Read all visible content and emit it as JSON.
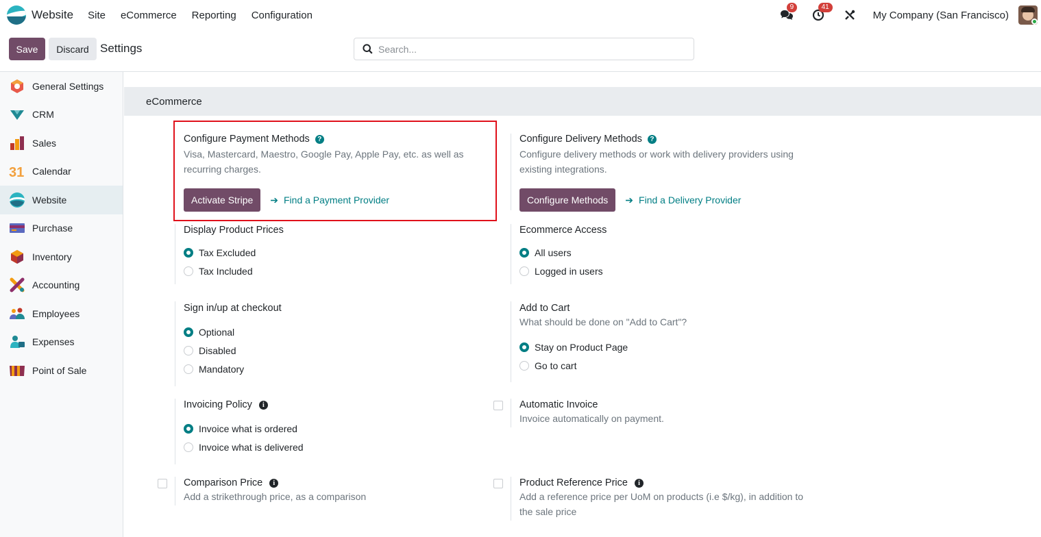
{
  "navbar": {
    "app_name": "Website",
    "menu": [
      "Site",
      "eCommerce",
      "Reporting",
      "Configuration"
    ],
    "messages_count": "9",
    "activities_count": "41",
    "company": "My Company (San Francisco)"
  },
  "control": {
    "save_label": "Save",
    "discard_label": "Discard",
    "title": "Settings",
    "search_placeholder": "Search..."
  },
  "sidebar": {
    "items": [
      {
        "label": "General Settings",
        "icon": "general-settings-icon"
      },
      {
        "label": "CRM",
        "icon": "crm-icon"
      },
      {
        "label": "Sales",
        "icon": "sales-icon"
      },
      {
        "label": "Calendar",
        "icon": "calendar-icon"
      },
      {
        "label": "Website",
        "icon": "website-icon",
        "active": true
      },
      {
        "label": "Purchase",
        "icon": "purchase-icon"
      },
      {
        "label": "Inventory",
        "icon": "inventory-icon"
      },
      {
        "label": "Accounting",
        "icon": "accounting-icon"
      },
      {
        "label": "Employees",
        "icon": "employees-icon"
      },
      {
        "label": "Expenses",
        "icon": "expenses-icon"
      },
      {
        "label": "Point of Sale",
        "icon": "point-of-sale-icon"
      }
    ],
    "calendar_number": "31"
  },
  "section": {
    "title": "eCommerce"
  },
  "payment": {
    "title": "Configure Payment Methods",
    "desc": "Visa, Mastercard, Maestro, Google Pay, Apple Pay, etc. as well as recurring charges.",
    "button": "Activate Stripe",
    "link": "Find a Payment Provider"
  },
  "delivery": {
    "title": "Configure Delivery Methods",
    "desc": "Configure delivery methods or work with delivery providers using existing integrations.",
    "button": "Configure Methods",
    "link": "Find a Delivery Provider"
  },
  "prices": {
    "title": "Display Product Prices",
    "options": [
      "Tax Excluded",
      "Tax Included"
    ],
    "selected": 0
  },
  "access": {
    "title": "Ecommerce Access",
    "options": [
      "All users",
      "Logged in users"
    ],
    "selected": 0
  },
  "signin": {
    "title": "Sign in/up at checkout",
    "options": [
      "Optional",
      "Disabled",
      "Mandatory"
    ],
    "selected": 0
  },
  "cart": {
    "title": "Add to Cart",
    "desc": "What should be done on \"Add to Cart\"?",
    "options": [
      "Stay on Product Page",
      "Go to cart"
    ],
    "selected": 0
  },
  "invoicing": {
    "title": "Invoicing Policy",
    "options": [
      "Invoice what is ordered",
      "Invoice what is delivered"
    ],
    "selected": 0
  },
  "auto_invoice": {
    "title": "Automatic Invoice",
    "desc": "Invoice automatically on payment."
  },
  "comparison": {
    "title": "Comparison Price",
    "desc": "Add a strikethrough price, as a comparison"
  },
  "reference": {
    "title": "Product Reference Price",
    "desc": "Add a reference price per UoM on products (i.e $/kg), in addition to the sale price"
  },
  "colors": {
    "primary": "#714b67",
    "accent": "#017e84",
    "highlight": "#e0101a"
  }
}
